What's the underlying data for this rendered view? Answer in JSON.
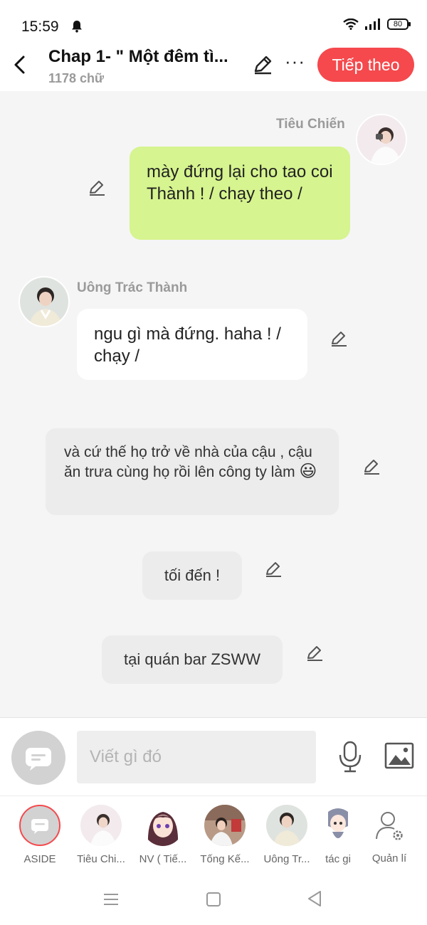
{
  "status": {
    "time": "15:59",
    "battery": "80"
  },
  "header": {
    "title": "Chap 1- \" Một đêm tì...",
    "word_count": "1178 chữ",
    "next_label": "Tiếp theo"
  },
  "messages": {
    "m1": {
      "sender": "Tiêu Chiến",
      "text": "mày đứng lại cho tao coi Thành ! / chạy theo /"
    },
    "m2": {
      "sender": "Uông Trác Thành",
      "text": "ngu gì mà đứng. haha ! / chạy /"
    },
    "n1": {
      "text": "và cứ thế họ trở về nhà của cậu , cậu ăn trưa cùng họ rồi lên công ty làm",
      "emoji": "😃"
    },
    "n2": {
      "text": "tối đến !"
    },
    "n3": {
      "text": "tại quán bar ZSWW"
    }
  },
  "input": {
    "placeholder": "Viết gì đó"
  },
  "characters": [
    {
      "label": "ASIDE"
    },
    {
      "label": "Tiêu Chi..."
    },
    {
      "label": "NV ( Tiế..."
    },
    {
      "label": "Tống Kế..."
    },
    {
      "label": "Uông Tr..."
    },
    {
      "label": "tác gi"
    },
    {
      "label": "Quản lí"
    }
  ],
  "colors": {
    "accent": "#f5494d",
    "own_bubble": "#d6f48f",
    "other_bubble": "#ffffff",
    "narration": "#ececec"
  }
}
